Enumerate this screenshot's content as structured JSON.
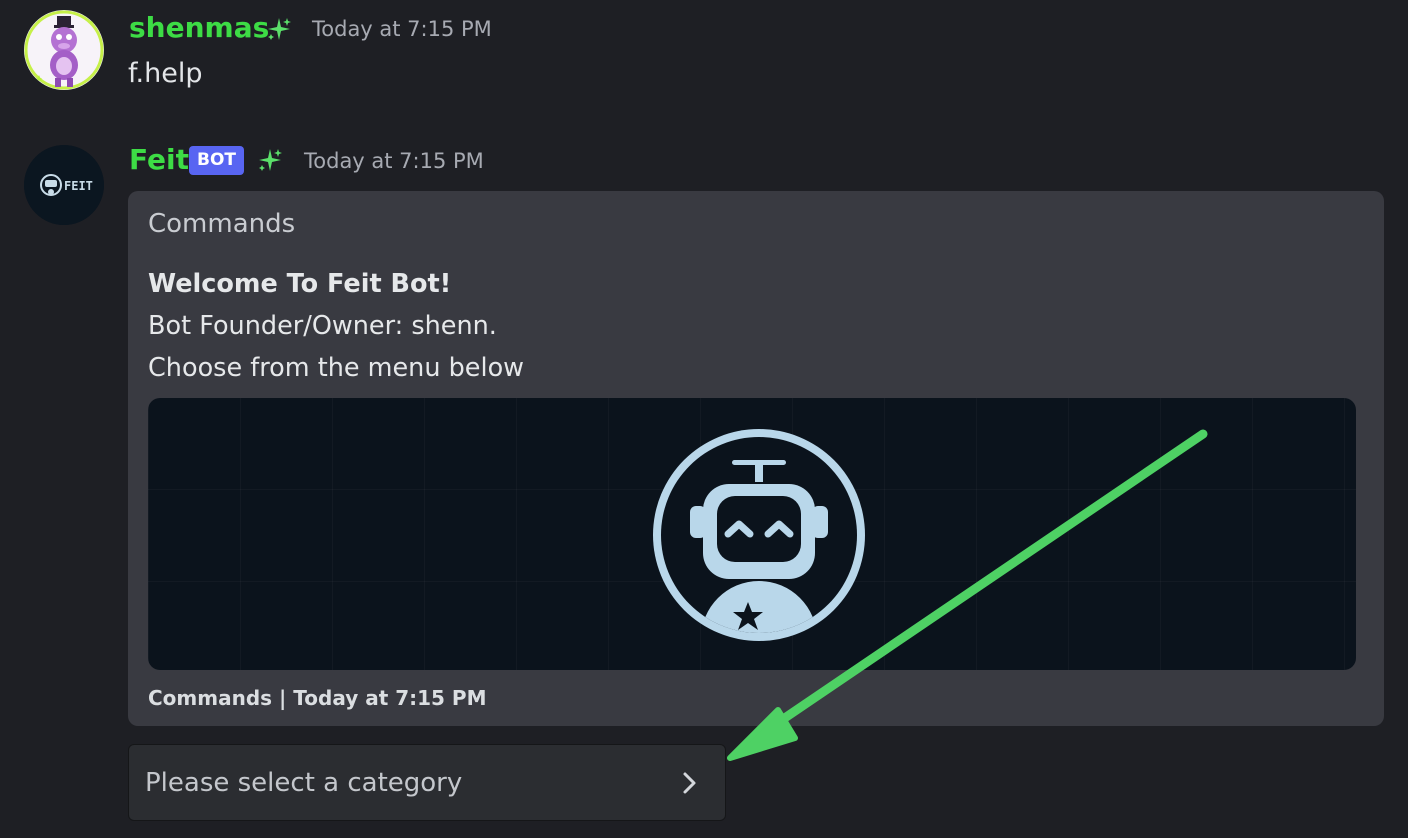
{
  "messages": [
    {
      "username": "shenmas",
      "timestamp": "Today at 7:15 PM",
      "text": "f.help",
      "badge_icon": "sparkle-icon"
    },
    {
      "username": "Feit",
      "tag": "BOT",
      "timestamp": "Today at 7:15 PM",
      "badge_icon": "sparkle-icon",
      "avatar_text": "FEIT",
      "embed": {
        "title": "Commands",
        "description": {
          "heading": "Welcome To Feit Bot!",
          "line1": "Bot Founder/Owner: shenn.",
          "line2": "Choose from the menu below"
        },
        "image": "feit-robot-logo",
        "footer": "Commands | Today at 7:15 PM"
      },
      "select": {
        "placeholder": "Please select a category"
      }
    }
  ],
  "colors": {
    "background": "#1e1f24",
    "username": "#3ddc45",
    "bot_tag": "#5865f2",
    "embed_bg": "#393a41",
    "annotation_arrow": "#4ed164",
    "logo": "#b9d7ea"
  }
}
